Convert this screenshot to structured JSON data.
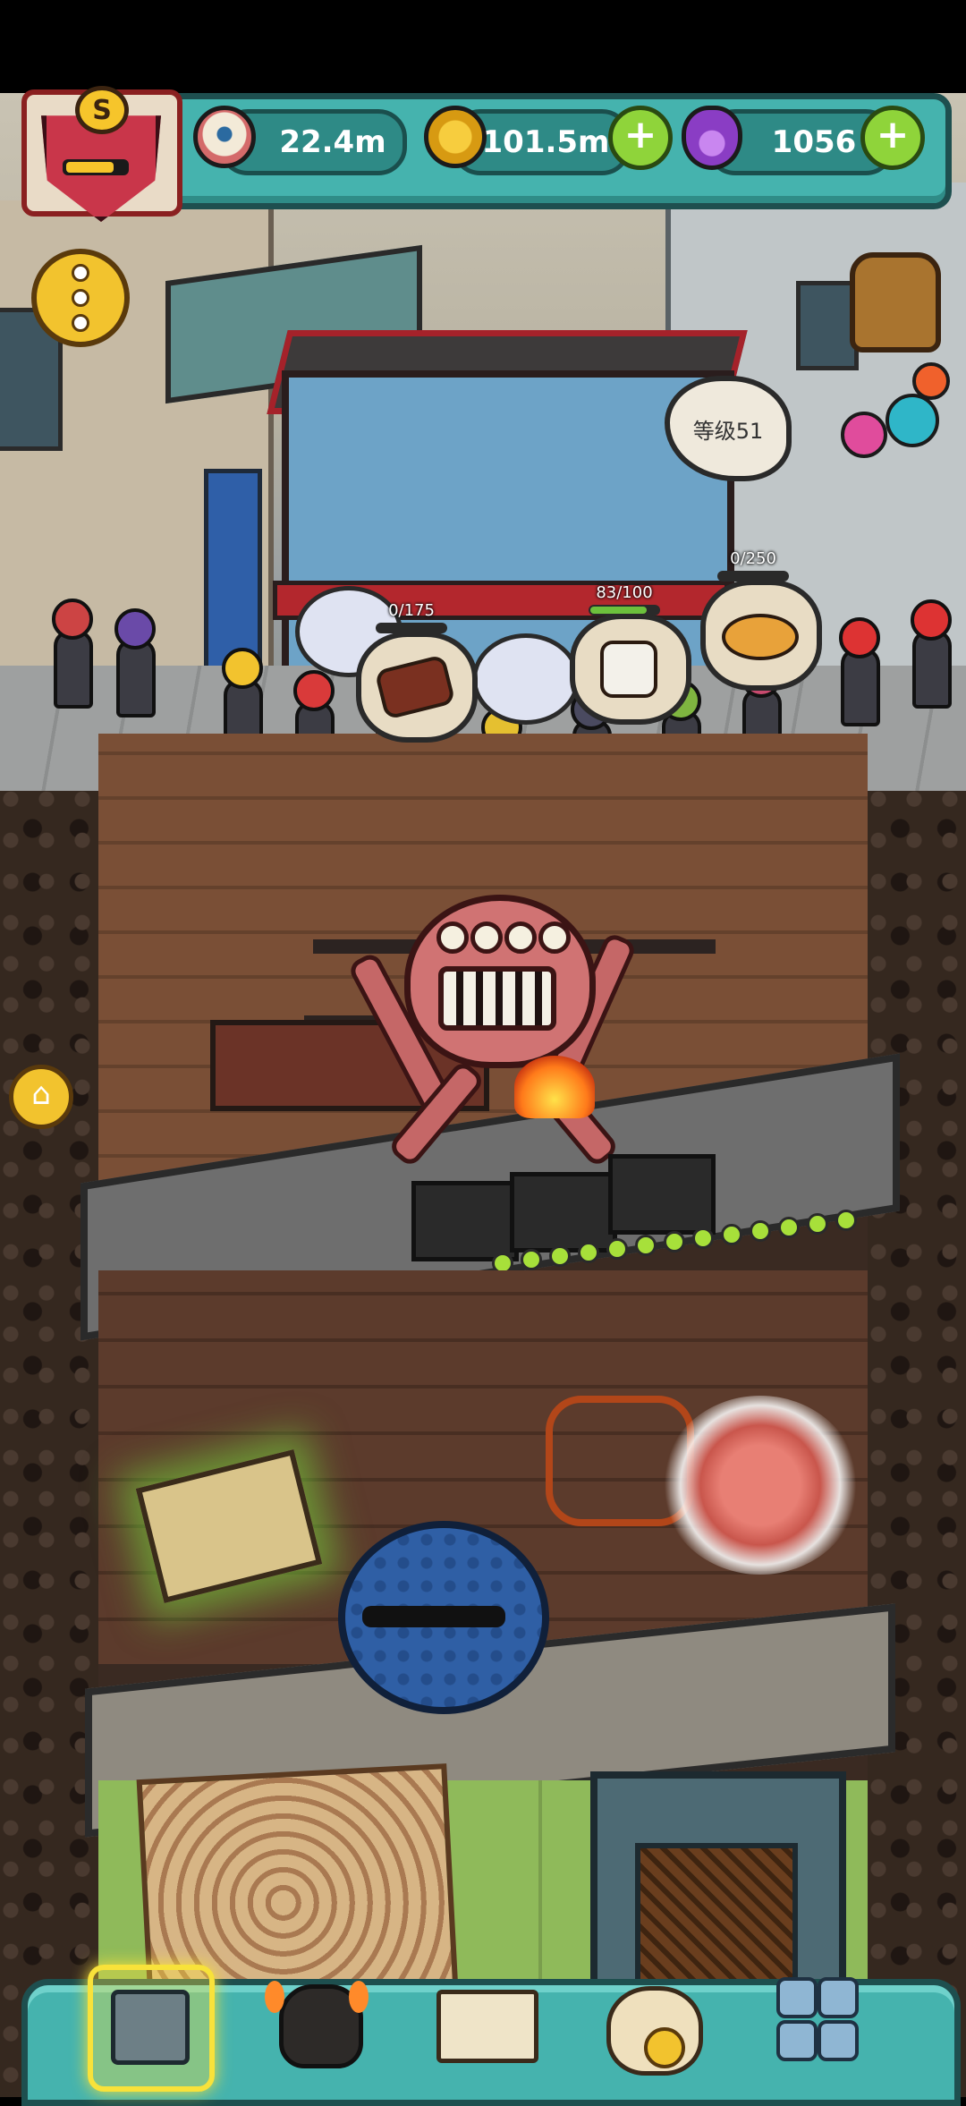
{
  "hud": {
    "rank_letter": "S",
    "rank_progress": 0.8,
    "eyes": {
      "value": "22.4m",
      "icon": "eyeball-icon"
    },
    "coins": {
      "value": "101.5m",
      "icon": "gold-coin-icon",
      "add": "+"
    },
    "potions": {
      "value": "1056",
      "icon": "purple-potion-icon",
      "add": "+"
    }
  },
  "scene": {
    "level_label": "等级51",
    "orders": [
      {
        "count": "0/175",
        "progress": 0.0,
        "dish": "grilled-steak-icon"
      },
      {
        "count": "83/100",
        "progress": 0.83,
        "dish": "rice-ball-icon"
      },
      {
        "count": "0/250",
        "progress": 0.0,
        "dish": "curry-plate-icon"
      }
    ]
  },
  "side_buttons": {
    "menu": "more-options-icon",
    "home": "home-icon"
  },
  "bottom_nav": [
    {
      "name": "restaurant-tab",
      "icon": "shop-icon",
      "selected": true
    },
    {
      "name": "monster-tab",
      "icon": "monster-icon",
      "selected": false
    },
    {
      "name": "recipe-book-tab",
      "icon": "book-icon",
      "selected": false
    },
    {
      "name": "money-bag-tab",
      "icon": "money-bag-icon",
      "selected": false
    },
    {
      "name": "more-tab",
      "icon": "grid-icon",
      "selected": false
    }
  ],
  "colors": {
    "hud": "#45b3ae",
    "accent_plus": "#8fd43a",
    "selected_glow": "#f8e23a"
  }
}
